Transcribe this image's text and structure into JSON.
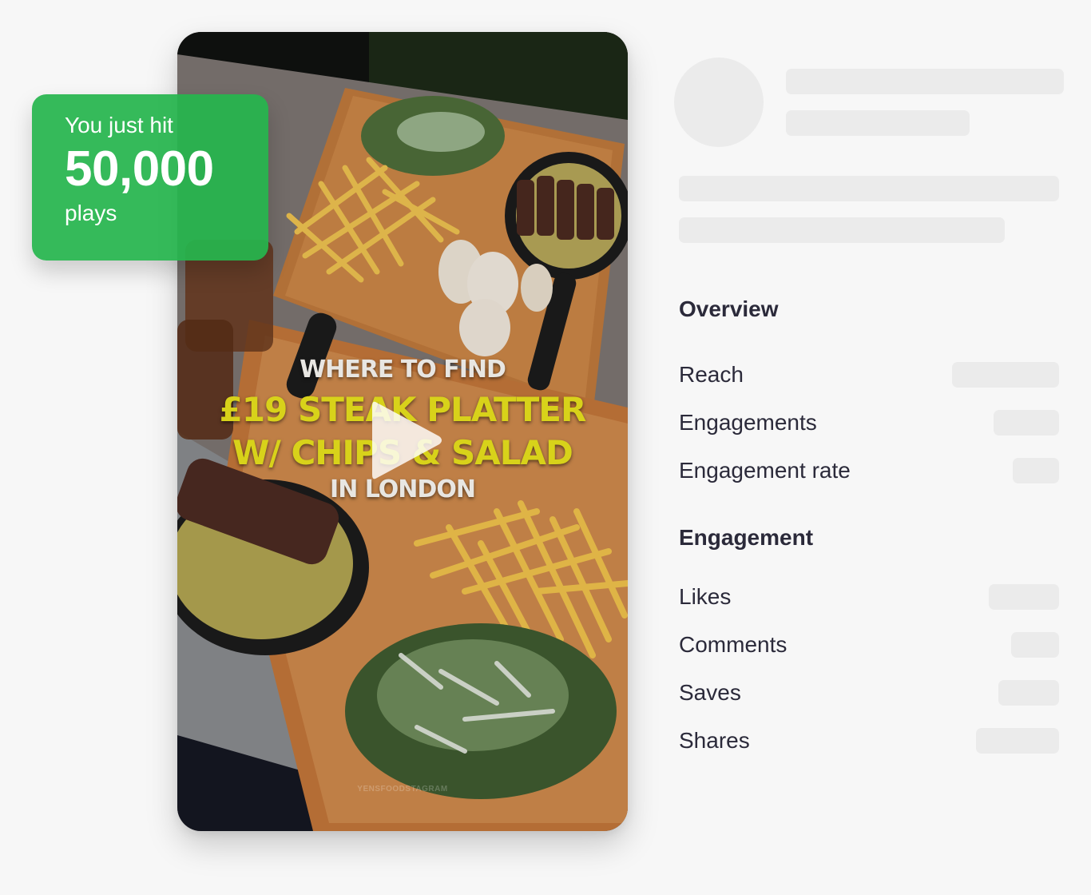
{
  "video": {
    "caption_lines": [
      "WHERE TO FIND",
      "£19 STEAK PLATTER",
      "W/ CHIPS & SALAD",
      "IN LONDON"
    ],
    "watermark": "YENSFOODSTAGRAM",
    "play_icon": "play-icon"
  },
  "milestone": {
    "prefix": "You just hit",
    "count": "50,000",
    "unit": "plays",
    "color": "#2ab34f"
  },
  "profile": {
    "avatar": "avatar-placeholder",
    "loading": true
  },
  "overview": {
    "title": "Overview",
    "metrics": [
      {
        "label": "Reach",
        "value": ""
      },
      {
        "label": "Engagements",
        "value": ""
      },
      {
        "label": "Engagement rate",
        "value": ""
      }
    ]
  },
  "engagement": {
    "title": "Engagement",
    "metrics": [
      {
        "label": "Likes",
        "value": ""
      },
      {
        "label": "Comments",
        "value": ""
      },
      {
        "label": "Saves",
        "value": ""
      },
      {
        "label": "Shares",
        "value": ""
      }
    ]
  },
  "colors": {
    "background": "#f7f7f7",
    "skeleton": "#ebebeb",
    "text": "#2b2a3a",
    "caption_yellow": "#d8d21a"
  }
}
